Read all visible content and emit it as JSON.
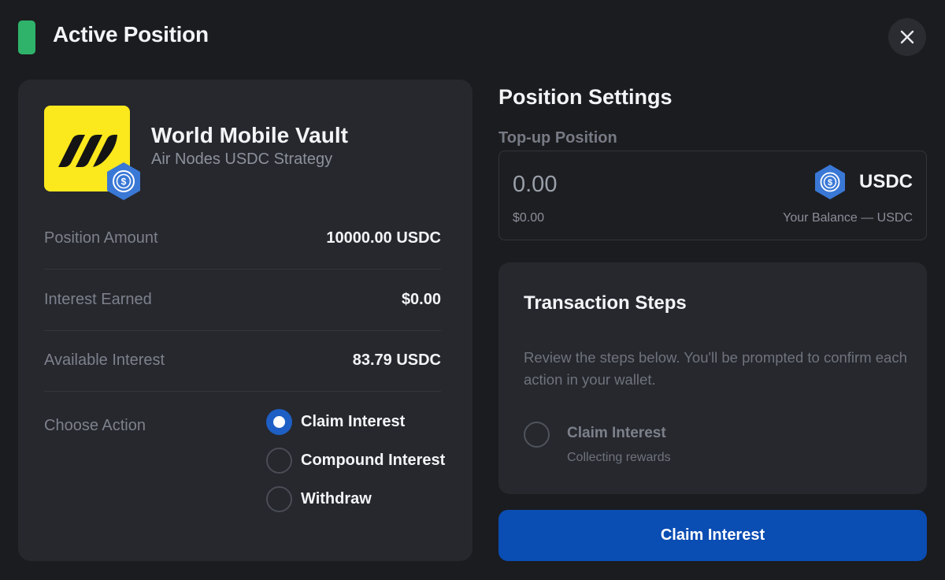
{
  "header": {
    "title": "Active Position",
    "accent_color": "#2fb36a",
    "close_icon": "close-icon"
  },
  "vault": {
    "name": "World Mobile Vault",
    "strategy": "Air Nodes USDC Strategy",
    "logo_color": "#fbe81d",
    "badge_icon": "usdc-icon"
  },
  "stats": [
    {
      "label": "Position Amount",
      "value": "10000.00 USDC"
    },
    {
      "label": "Interest Earned",
      "value": "$0.00"
    },
    {
      "label": "Available Interest",
      "value": "83.79 USDC"
    }
  ],
  "action": {
    "label": "Choose Action",
    "options": [
      {
        "label": "Claim Interest",
        "selected": true
      },
      {
        "label": "Compound Interest",
        "selected": false
      },
      {
        "label": "Withdraw",
        "selected": false
      }
    ]
  },
  "settings": {
    "title": "Position Settings",
    "topup_label": "Top-up Position",
    "amount_placeholder": "0.00",
    "token": "USDC",
    "usd_value": "$0.00",
    "balance_text": "Your Balance — USDC"
  },
  "steps": {
    "title": "Transaction Steps",
    "description": "Review the steps below. You'll be prompted to confirm each action in your wallet.",
    "items": [
      {
        "name": "Claim Interest",
        "sub": "Collecting rewards"
      }
    ]
  },
  "primary_button": {
    "label": "Claim Interest",
    "color": "#0a4db3"
  }
}
